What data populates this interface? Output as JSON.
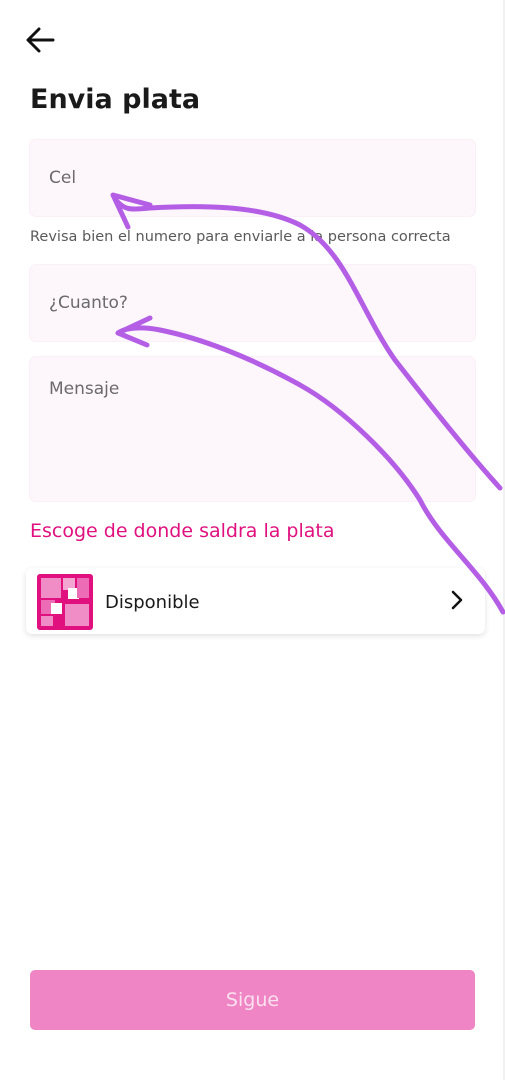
{
  "header": {
    "back_icon": "arrow-left-icon",
    "title": "Envia plata"
  },
  "form": {
    "phone_placeholder": "Cel",
    "phone_value": "",
    "phone_helper": "Revisa bien el numero para enviarle a la persona correcta",
    "amount_placeholder": "¿Cuanto?",
    "amount_value": "",
    "message_placeholder": "Mensaje",
    "message_value": ""
  },
  "source": {
    "section_label": "Escoge de donde saldra la plata",
    "item_label": "Disponible",
    "item_icon": "account-logo-icon",
    "chevron_icon": "chevron-right-icon"
  },
  "footer": {
    "submit_label": "Sigue"
  },
  "colors": {
    "accent": "#e0117f",
    "button_bg": "#ef85c4",
    "field_bg": "#fdf6fb",
    "annotation": "#b45ee6"
  }
}
